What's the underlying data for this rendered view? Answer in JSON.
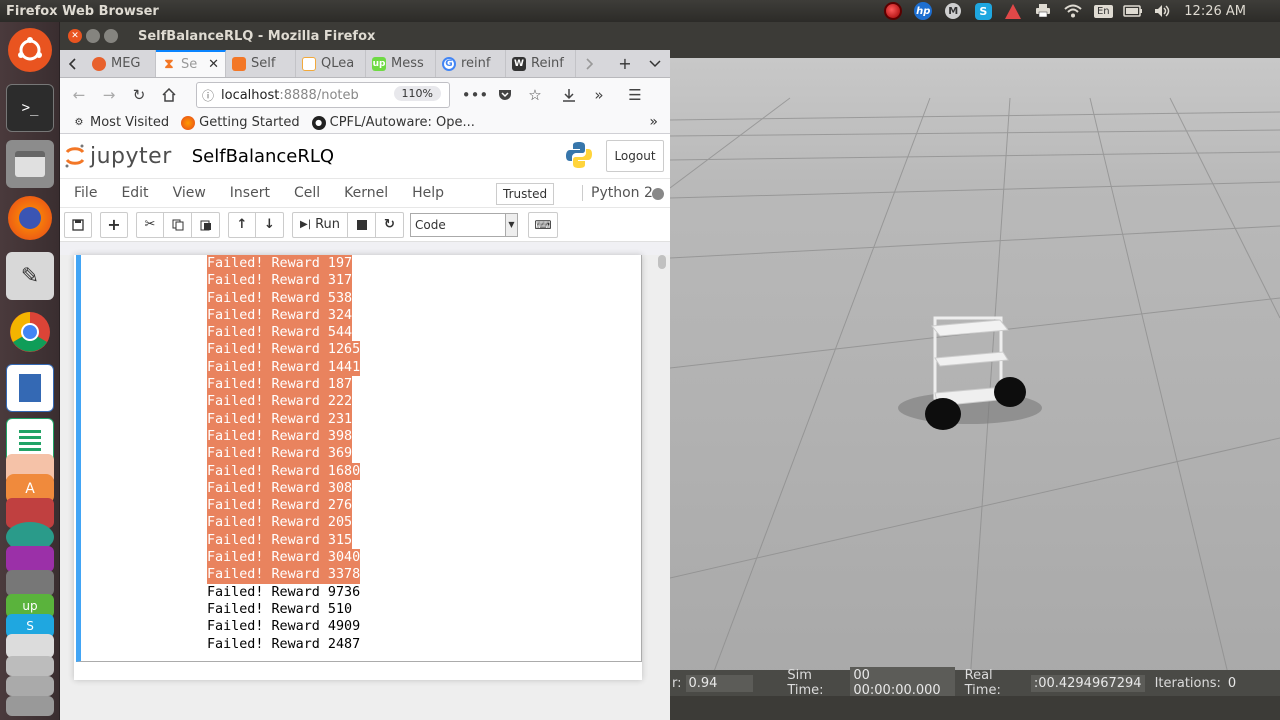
{
  "top_panel": {
    "app_title": "Firefox Web Browser",
    "clock": "12:26 AM",
    "keyboard": "En",
    "tray_icons": [
      "record-icon",
      "hp-icon",
      "m-icon",
      "skype-icon",
      "warning-icon",
      "printer-icon",
      "wifi-icon",
      "keyboard-icon",
      "battery-icon",
      "volume-icon"
    ]
  },
  "launcher": {
    "items": [
      "ubuntu-dash",
      "terminal",
      "files",
      "firefox",
      "text-editor",
      "chrome",
      "writer",
      "calc",
      "impress",
      "software",
      "gazebo",
      "app",
      "upwork",
      "skype",
      "app2",
      "app3",
      "app4"
    ]
  },
  "window": {
    "title": "SelfBalanceRLQ - Mozilla Firefox"
  },
  "tabs": [
    {
      "label": "MEG",
      "favicon_color": "#e8612c",
      "active": false
    },
    {
      "label": "Se",
      "favicon_color": "#f37726",
      "active": true
    },
    {
      "label": "Self",
      "favicon_color": "#f37726",
      "active": false
    },
    {
      "label": "QLea",
      "favicon_color": "#f2a93b",
      "active": false
    },
    {
      "label": "Mess",
      "favicon_color": "#6fda44",
      "active": false
    },
    {
      "label": "reinf",
      "favicon_color": "#4285f4",
      "active": false
    },
    {
      "label": "Reinf",
      "favicon_color": "#333333",
      "active": false
    }
  ],
  "navbar": {
    "url_host": "localhost",
    "url_rest": ":8888/noteb",
    "zoom": "110%"
  },
  "bookmarks": [
    {
      "label": "Most Visited",
      "icon": "gear-icon"
    },
    {
      "label": "Getting Started",
      "icon": "firefox-icon"
    },
    {
      "label": "CPFL/Autoware: Ope...",
      "icon": "github-icon"
    }
  ],
  "jupyter": {
    "logo": "jupyter",
    "notebook_name": "SelfBalanceRLQ",
    "logout": "Logout",
    "menu": [
      "File",
      "Edit",
      "View",
      "Insert",
      "Cell",
      "Kernel",
      "Help"
    ],
    "trusted": "Trusted",
    "kernel": "Python 2",
    "toolbar": {
      "run_label": "Run",
      "cell_type": "Code"
    }
  },
  "output": {
    "lines": [
      {
        "text": "Failed! Reward 197",
        "selected": true
      },
      {
        "text": "Failed! Reward 317",
        "selected": true
      },
      {
        "text": "Failed! Reward 538",
        "selected": true
      },
      {
        "text": "Failed! Reward 324",
        "selected": true
      },
      {
        "text": "Failed! Reward 544",
        "selected": true
      },
      {
        "text": "Failed! Reward 1265",
        "selected": true
      },
      {
        "text": "Failed! Reward 1441",
        "selected": true
      },
      {
        "text": "Failed! Reward 187",
        "selected": true
      },
      {
        "text": "Failed! Reward 222",
        "selected": true
      },
      {
        "text": "Failed! Reward 231",
        "selected": true
      },
      {
        "text": "Failed! Reward 398",
        "selected": true
      },
      {
        "text": "Failed! Reward 369",
        "selected": true
      },
      {
        "text": "Failed! Reward 1680",
        "selected": true
      },
      {
        "text": "Failed! Reward 308",
        "selected": true
      },
      {
        "text": "Failed! Reward 276",
        "selected": true
      },
      {
        "text": "Failed! Reward 205",
        "selected": true
      },
      {
        "text": "Failed! Reward 315",
        "selected": true
      },
      {
        "text": "Failed! Reward 3040",
        "selected": true
      },
      {
        "text": "Failed! Reward 3378",
        "selected": true
      },
      {
        "text": "Failed! Reward 9736",
        "selected": false
      },
      {
        "text": "Failed! Reward 510",
        "selected": false
      },
      {
        "text": "Failed! Reward 4909",
        "selected": false
      },
      {
        "text": "Failed! Reward 2487",
        "selected": false
      }
    ]
  },
  "gazebo": {
    "factor_label": "r:",
    "factor_value": "0.94",
    "sim_time_label": "Sim Time:",
    "sim_time_value": "00 00:00:00.000",
    "real_time_label": "Real Time:",
    "real_time_value": ":00.4294967294",
    "iterations_label": "Iterations:",
    "iterations_value": "0"
  },
  "colors": {
    "selection": "#e9835e",
    "cell_border": "#42a5f5",
    "jupyter_orange": "#f37726",
    "ubuntu_orange": "#e95420"
  }
}
